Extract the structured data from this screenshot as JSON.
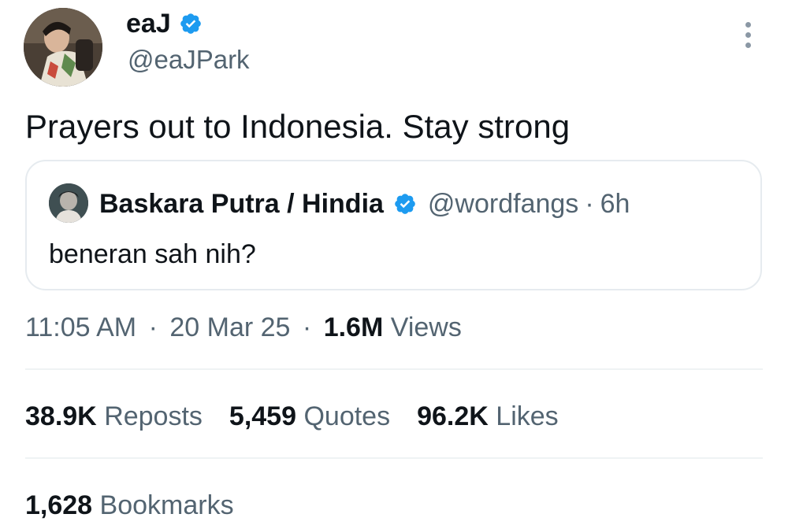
{
  "author": {
    "display_name": "eaJ",
    "handle": "@eaJPark"
  },
  "tweet": {
    "text": "Prayers out to Indonesia. Stay strong"
  },
  "quoted_tweet": {
    "display_name": "Baskara Putra / Hindia",
    "handle": "@wordfangs",
    "separator": "·",
    "age": "6h",
    "text": "beneran sah nih?"
  },
  "meta": {
    "time": "11:05 AM",
    "date": "20 Mar 25",
    "separator": "·",
    "views_count": "1.6M",
    "views_label": "Views"
  },
  "stats": {
    "reposts_count": "38.9K",
    "reposts_label": "Reposts",
    "quotes_count": "5,459",
    "quotes_label": "Quotes",
    "likes_count": "96.2K",
    "likes_label": "Likes",
    "bookmarks_count": "1,628",
    "bookmarks_label": "Bookmarks"
  },
  "icons": {
    "verified": "verified-badge-icon",
    "more": "more-vertical-icon"
  },
  "colors": {
    "verified_blue": "#1d9bf0",
    "primary_text": "#0f1419",
    "secondary_text": "#536471",
    "divider": "#eff3f4"
  }
}
